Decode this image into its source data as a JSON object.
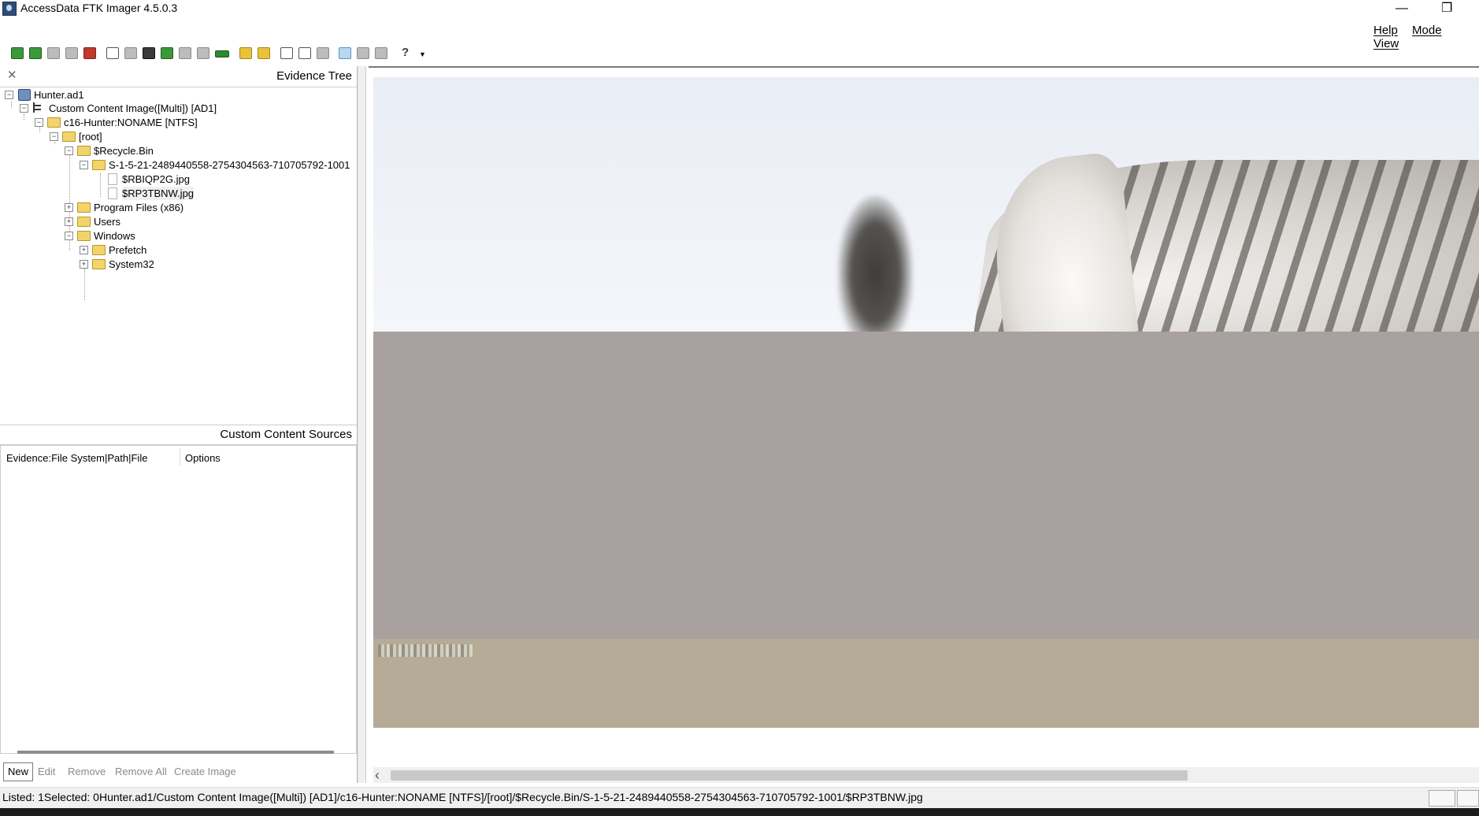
{
  "window": {
    "title": "AccessData FTK Imager 4.5.0.3"
  },
  "menu": {
    "items": [
      "Help",
      "Mode",
      "View"
    ]
  },
  "evidence_tree": {
    "title": "Evidence Tree",
    "nodes": [
      {
        "label": "Hunter.ad1",
        "expander": "−"
      },
      {
        "label": "Custom Content Image([Multi]) [AD1]",
        "expander": "−"
      },
      {
        "label": "c16-Hunter:NONAME [NTFS]",
        "expander": "−"
      },
      {
        "label": "[root]",
        "expander": "−"
      },
      {
        "label": "$Recycle.Bin",
        "expander": "−"
      },
      {
        "label": "S-1-5-21-2489440558-2754304563-710705792-1001",
        "expander": "−"
      },
      {
        "label": "$RBIQP2G.jpg",
        "expander": ""
      },
      {
        "label": "$RP3TBNW.jpg",
        "expander": ""
      },
      {
        "label": "Program Files (x86)",
        "expander": "+"
      },
      {
        "label": "Users",
        "expander": "+"
      },
      {
        "label": "Windows",
        "expander": "−"
      },
      {
        "label": "Prefetch",
        "expander": "+"
      },
      {
        "label": "System32",
        "expander": "+"
      }
    ]
  },
  "custom_content_sources": {
    "title": "Custom Content Sources",
    "columns": [
      "Evidence:File System|Path|File",
      "Options"
    ],
    "buttons": {
      "new": "New",
      "edit": "Edit",
      "remove": "Remove",
      "remove_all": "Remove All",
      "create_image": "Create Image"
    }
  },
  "status_bar": {
    "text": "Listed: 1Selected: 0Hunter.ad1/Custom Content Image([Multi]) [AD1]/c16-Hunter:NONAME [NTFS]/[root]/$Recycle.Bin/S-1-5-21-2489440558-2754304563-710705792-1001/$RP3TBNW.jpg"
  },
  "icons": {
    "app": "ftk-imager-icon",
    "toolbar": [
      "add-evidence-icon",
      "add-all-evidence-icon",
      "image-mounting-icon",
      "unmount-icon",
      "remove-evidence-icon",
      "create-disk-image-icon",
      "export-disk-image-icon",
      "export-logical-image-icon",
      "add-to-custom-content-icon",
      "create-custom-content-image-icon",
      "decrypt-ad1-icon",
      "capture-memory-icon",
      "obtain-protected-files-icon",
      "detect-efs-icon",
      "export-files-icon",
      "export-file-hash-list-icon",
      "export-directory-listing-icon",
      "auto-view-icon",
      "text-view-icon",
      "hex-view-icon",
      "help-icon"
    ]
  },
  "colors": {
    "folder": "#f2d46b",
    "toolbar_active": "#b9d6f2"
  }
}
